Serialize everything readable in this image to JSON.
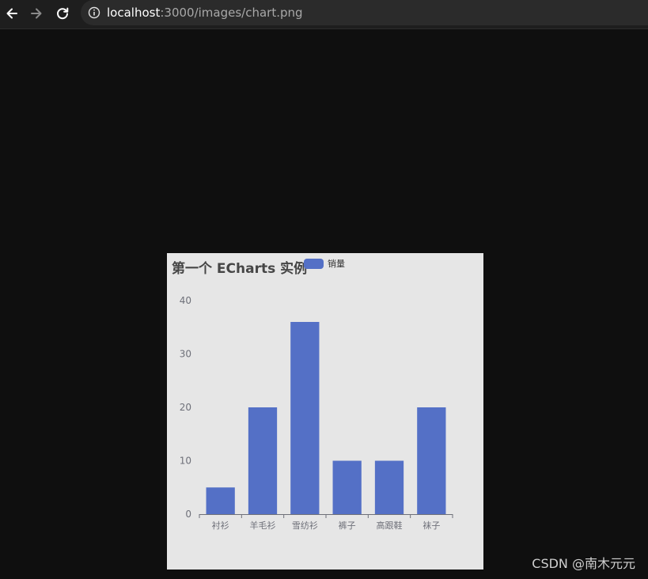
{
  "browser": {
    "url_host": "localhost",
    "url_rest": ":3000/images/chart.png"
  },
  "colors": {
    "bar": "#5470c6",
    "axis_label": "#6e7079",
    "axis_line": "#6e7079",
    "card_bg": "#e6e6e6"
  },
  "icons": [
    "back-arrow-icon",
    "forward-arrow-icon",
    "reload-icon",
    "info-icon"
  ],
  "chart_data": {
    "type": "bar",
    "title": "第一个 ECharts 实例",
    "legend": [
      "销量"
    ],
    "legend_position": "top",
    "categories": [
      "衬衫",
      "羊毛衫",
      "雪纺衫",
      "裤子",
      "高跟鞋",
      "袜子"
    ],
    "series": [
      {
        "name": "销量",
        "values": [
          5,
          20,
          36,
          10,
          10,
          20
        ]
      }
    ],
    "ylim": [
      0,
      40
    ],
    "yticks": [
      0,
      10,
      20,
      30,
      40
    ],
    "grid": false
  },
  "watermark": "CSDN @南木元元"
}
